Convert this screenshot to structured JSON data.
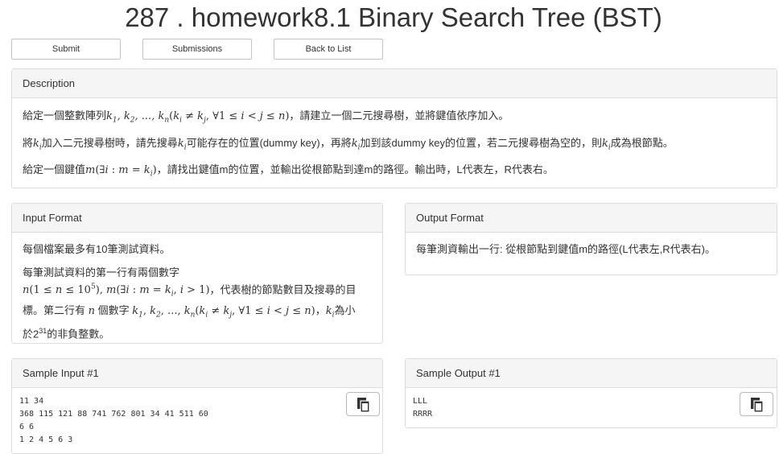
{
  "page": {
    "title": "287 . homework8.1 Binary Search Tree (BST)"
  },
  "toolbar": {
    "submit_label": "Submit",
    "submissions_label": "Submissions",
    "back_label": "Back to List"
  },
  "description": {
    "heading": "Description",
    "line1_a": "給定一個整數陣列",
    "line1_b": "，請建立一個二元搜尋樹，並將鍵值依序加入。",
    "line2_a": "將",
    "line2_b": "加入二元搜尋樹時，請先搜尋",
    "line2_c": "可能存在的位置(dummy key)，再將",
    "line2_d": "加到該dummy key的位置，若二元搜尋樹為空的，則",
    "line2_e": "成為根節點。",
    "line3_a": "給定一個鍵值",
    "line3_b": "，請找出鍵值m的位置，並輸出從根節點到達m的路徑。輸出時，L代表左，R代表右。"
  },
  "input_format": {
    "heading": "Input Format",
    "p1": "每個檔案最多有10筆測試資料。",
    "p2_a": "每筆測試資料的第一行有兩個數字",
    "p2_b": "，代表樹的節點數目及搜尋的目",
    "p2_c": "標。第二行有",
    "p2_d": "個數字",
    "p2_e": "，",
    "p2_f": "為小",
    "p2_g": "於2",
    "p2_g_sup": "31",
    "p2_h": "的非負整數。"
  },
  "output_format": {
    "heading": "Output Format",
    "p1": "每筆測資輸出一行: 從根節點到鍵值m的路徑(L代表左,R代表右)。"
  },
  "sample_input": {
    "heading": "Sample Input #1",
    "content": "11 34\n368 115 121 88 741 762 801 34 41 511 60\n6 6\n1 2 4 5 6 3"
  },
  "sample_output": {
    "heading": "Sample Output #1",
    "content": "LLL\nRRRR"
  },
  "icons": {
    "copy_input": "copy-icon",
    "copy_output": "copy-icon"
  }
}
